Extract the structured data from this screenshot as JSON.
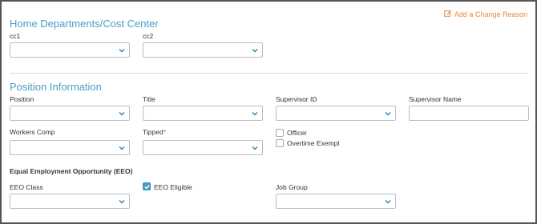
{
  "header": {
    "change_reason_label": "Add a Change Reason"
  },
  "home_departments": {
    "title": "Home Departments/Cost Center",
    "cc1_label": "cc1",
    "cc2_label": "cc2",
    "cc1_value": "",
    "cc2_value": ""
  },
  "position_info": {
    "title": "Position Information",
    "position_label": "Position",
    "title_label": "Title",
    "supervisor_id_label": "Supervisor ID",
    "supervisor_name_label": "Supervisor Name",
    "workers_comp_label": "Workers Comp",
    "tipped_label": "Tipped",
    "tipped_required_mark": "*",
    "officer_label": "Officer",
    "officer_checked": false,
    "overtime_exempt_label": "Overtime Exempt",
    "overtime_exempt_checked": false
  },
  "eeo": {
    "heading": "Equal Employment Opportunity (EEO)",
    "class_label": "EEO Class",
    "eligible_label": "EEO Eligible",
    "eligible_checked": true,
    "job_group_label": "Job Group"
  },
  "colors": {
    "section_title": "#4a9cc6",
    "change_reason": "#e8843a",
    "chevron": "#2f7fb0",
    "required": "#d9534f"
  }
}
